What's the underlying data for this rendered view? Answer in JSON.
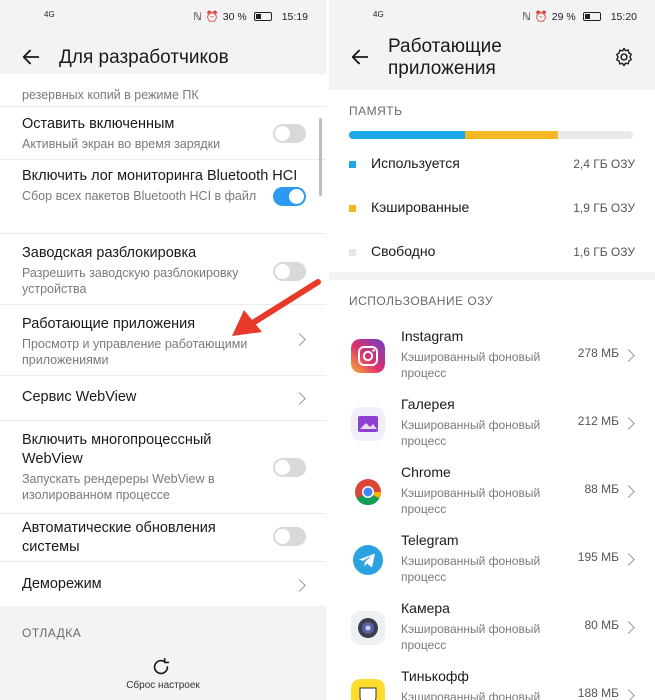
{
  "left": {
    "status": {
      "network": "4G",
      "battery": "30 %",
      "time": "15:19"
    },
    "title": "Для разработчиков",
    "cut_text": "резервных копий в режиме ПК",
    "items": [
      {
        "title": "Оставить включенным",
        "subtitle": "Активный экран во время зарядки",
        "control": "toggle",
        "on": false
      },
      {
        "title": "Включить лог мониторинга Bluetooth HCI",
        "subtitle": "Сбор всех пакетов Bluetooth HCI в файл",
        "control": "toggle",
        "on": true
      },
      {
        "title": "Заводская разблокировка",
        "subtitle": "Разрешить заводскую разблокировку устройства",
        "control": "toggle",
        "on": false
      },
      {
        "title": "Работающие приложения",
        "subtitle": "Просмотр и управление работающими приложениями",
        "control": "chevron"
      },
      {
        "title": "Сервис WebView",
        "subtitle": "",
        "control": "chevron"
      },
      {
        "title": "Включить многопроцессный WebView",
        "subtitle": "Запускать рендереры WebView в изолированном процессе",
        "control": "toggle",
        "on": false
      },
      {
        "title": "Автоматические обновления системы",
        "subtitle": "",
        "control": "toggle",
        "on": false
      },
      {
        "title": "Деморежим",
        "subtitle": "",
        "control": "chevron"
      }
    ],
    "section": "ОТЛАДКА",
    "reset_label": "Сброс настроек",
    "annotation_color": "#e8392a"
  },
  "right": {
    "status": {
      "network": "4G",
      "battery": "29 %",
      "time": "15:20"
    },
    "title_line1": "Работающие",
    "title_line2": "приложения",
    "memory_header": "ПАМЯТЬ",
    "memory_bar": {
      "used_fraction": 0.41,
      "cached_fraction": 0.325
    },
    "memory": [
      {
        "label": "Используется",
        "value": "2,4 ГБ ОЗУ",
        "color": "#1fa7ea"
      },
      {
        "label": "Кэшированные",
        "value": "1,9 ГБ ОЗУ",
        "color": "#f5b822"
      },
      {
        "label": "Свободно",
        "value": "1,6 ГБ ОЗУ",
        "color": "#e6e6e6"
      }
    ],
    "ram_header": "ИСПОЛЬЗОВАНИЕ ОЗУ",
    "apps": [
      {
        "name": "Instagram",
        "status": "Кэшированный фоновый процесс",
        "size": "278 МБ",
        "icon": "instagram-icon"
      },
      {
        "name": "Галерея",
        "status": "Кэшированный фоновый процесс",
        "size": "212 МБ",
        "icon": "gallery-icon"
      },
      {
        "name": "Chrome",
        "status": "Кэшированный фоновый процесс",
        "size": "88 МБ",
        "icon": "chrome-icon"
      },
      {
        "name": "Telegram",
        "status": "Кэшированный фоновый процесс",
        "size": "195 МБ",
        "icon": "telegram-icon"
      },
      {
        "name": "Камера",
        "status": "Кэшированный фоновый процесс",
        "size": "80 МБ",
        "icon": "camera-icon"
      },
      {
        "name": "Тинькофф",
        "status": "Кэшированный фоновый процесс",
        "size": "188 МБ",
        "icon": "tinkoff-icon"
      }
    ]
  }
}
